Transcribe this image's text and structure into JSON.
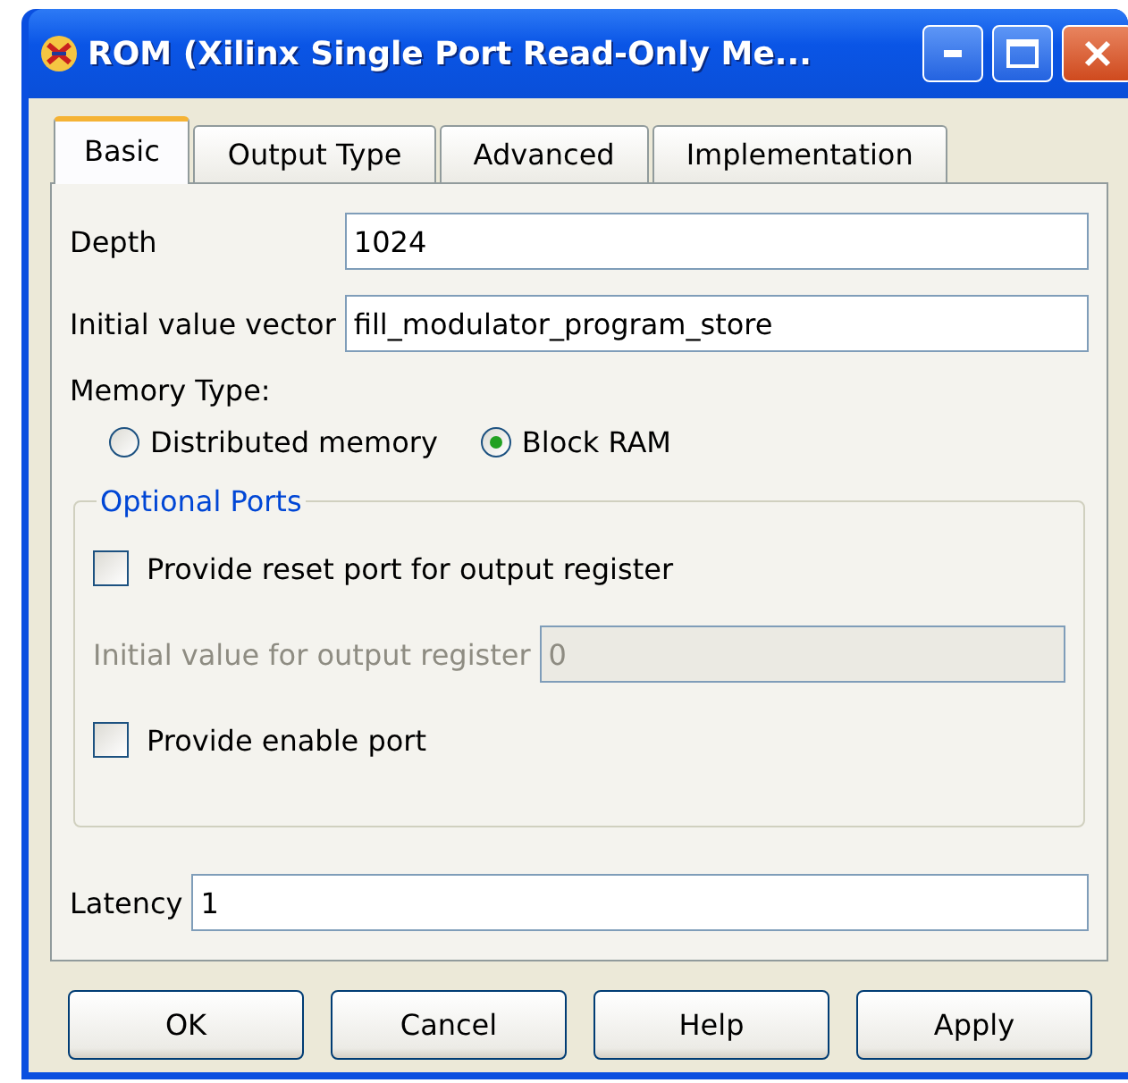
{
  "window": {
    "title": "ROM (Xilinx Single Port Read-Only Me..."
  },
  "tabs": [
    {
      "label": "Basic",
      "selected": true
    },
    {
      "label": "Output Type",
      "selected": false
    },
    {
      "label": "Advanced",
      "selected": false
    },
    {
      "label": "Implementation",
      "selected": false
    }
  ],
  "fields": [
    {
      "label": "Depth",
      "value": "1024"
    },
    {
      "label": "Initial value vector",
      "value": "fill_modulator_program_store"
    }
  ],
  "memory_type": {
    "label": "Memory Type:",
    "options": [
      {
        "label": "Distributed memory",
        "selected": false
      },
      {
        "label": "Block RAM",
        "selected": true
      }
    ]
  },
  "optional_ports": {
    "title": "Optional Ports",
    "items": [
      {
        "kind": "checkbox",
        "label": "Provide reset port for output register",
        "checked": false
      },
      {
        "kind": "field",
        "label": "Initial value for output register",
        "value": "0",
        "disabled": true
      },
      {
        "kind": "checkbox",
        "label": "Provide enable port",
        "checked": false
      }
    ]
  },
  "latency": {
    "label": "Latency",
    "value": "1"
  },
  "buttons": [
    "OK",
    "Cancel",
    "Help",
    "Apply"
  ]
}
